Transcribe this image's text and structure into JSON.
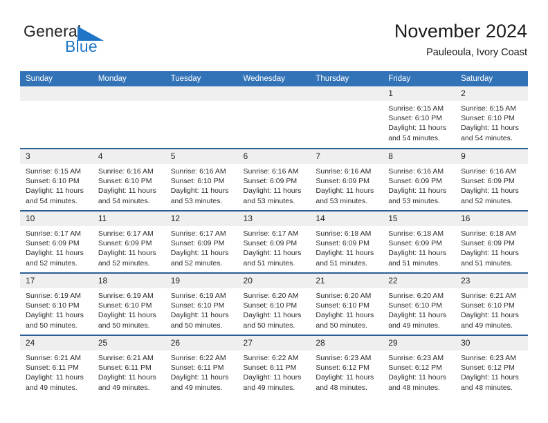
{
  "brand": {
    "name_part1": "General",
    "name_part2": "Blue",
    "triangle_color": "#1f76c7"
  },
  "header": {
    "title": "November 2024",
    "subtitle": "Pauleoula, Ivory Coast"
  },
  "theme": {
    "header_blue": "#3273b8",
    "row_divider": "#2a5f96",
    "daynum_band": "#efefef"
  },
  "weekdays": [
    "Sunday",
    "Monday",
    "Tuesday",
    "Wednesday",
    "Thursday",
    "Friday",
    "Saturday"
  ],
  "labels": {
    "sunrise": "Sunrise:",
    "sunset": "Sunset:",
    "daylight": "Daylight:"
  },
  "weeks": [
    [
      {
        "blank": true
      },
      {
        "blank": true
      },
      {
        "blank": true
      },
      {
        "blank": true
      },
      {
        "blank": true
      },
      {
        "day": "1",
        "sunrise": "Sunrise: 6:15 AM",
        "sunset": "Sunset: 6:10 PM",
        "daylight": "Daylight: 11 hours and 54 minutes."
      },
      {
        "day": "2",
        "sunrise": "Sunrise: 6:15 AM",
        "sunset": "Sunset: 6:10 PM",
        "daylight": "Daylight: 11 hours and 54 minutes."
      }
    ],
    [
      {
        "day": "3",
        "sunrise": "Sunrise: 6:15 AM",
        "sunset": "Sunset: 6:10 PM",
        "daylight": "Daylight: 11 hours and 54 minutes."
      },
      {
        "day": "4",
        "sunrise": "Sunrise: 6:16 AM",
        "sunset": "Sunset: 6:10 PM",
        "daylight": "Daylight: 11 hours and 54 minutes."
      },
      {
        "day": "5",
        "sunrise": "Sunrise: 6:16 AM",
        "sunset": "Sunset: 6:10 PM",
        "daylight": "Daylight: 11 hours and 53 minutes."
      },
      {
        "day": "6",
        "sunrise": "Sunrise: 6:16 AM",
        "sunset": "Sunset: 6:09 PM",
        "daylight": "Daylight: 11 hours and 53 minutes."
      },
      {
        "day": "7",
        "sunrise": "Sunrise: 6:16 AM",
        "sunset": "Sunset: 6:09 PM",
        "daylight": "Daylight: 11 hours and 53 minutes."
      },
      {
        "day": "8",
        "sunrise": "Sunrise: 6:16 AM",
        "sunset": "Sunset: 6:09 PM",
        "daylight": "Daylight: 11 hours and 53 minutes."
      },
      {
        "day": "9",
        "sunrise": "Sunrise: 6:16 AM",
        "sunset": "Sunset: 6:09 PM",
        "daylight": "Daylight: 11 hours and 52 minutes."
      }
    ],
    [
      {
        "day": "10",
        "sunrise": "Sunrise: 6:17 AM",
        "sunset": "Sunset: 6:09 PM",
        "daylight": "Daylight: 11 hours and 52 minutes."
      },
      {
        "day": "11",
        "sunrise": "Sunrise: 6:17 AM",
        "sunset": "Sunset: 6:09 PM",
        "daylight": "Daylight: 11 hours and 52 minutes."
      },
      {
        "day": "12",
        "sunrise": "Sunrise: 6:17 AM",
        "sunset": "Sunset: 6:09 PM",
        "daylight": "Daylight: 11 hours and 52 minutes."
      },
      {
        "day": "13",
        "sunrise": "Sunrise: 6:17 AM",
        "sunset": "Sunset: 6:09 PM",
        "daylight": "Daylight: 11 hours and 51 minutes."
      },
      {
        "day": "14",
        "sunrise": "Sunrise: 6:18 AM",
        "sunset": "Sunset: 6:09 PM",
        "daylight": "Daylight: 11 hours and 51 minutes."
      },
      {
        "day": "15",
        "sunrise": "Sunrise: 6:18 AM",
        "sunset": "Sunset: 6:09 PM",
        "daylight": "Daylight: 11 hours and 51 minutes."
      },
      {
        "day": "16",
        "sunrise": "Sunrise: 6:18 AM",
        "sunset": "Sunset: 6:09 PM",
        "daylight": "Daylight: 11 hours and 51 minutes."
      }
    ],
    [
      {
        "day": "17",
        "sunrise": "Sunrise: 6:19 AM",
        "sunset": "Sunset: 6:10 PM",
        "daylight": "Daylight: 11 hours and 50 minutes."
      },
      {
        "day": "18",
        "sunrise": "Sunrise: 6:19 AM",
        "sunset": "Sunset: 6:10 PM",
        "daylight": "Daylight: 11 hours and 50 minutes."
      },
      {
        "day": "19",
        "sunrise": "Sunrise: 6:19 AM",
        "sunset": "Sunset: 6:10 PM",
        "daylight": "Daylight: 11 hours and 50 minutes."
      },
      {
        "day": "20",
        "sunrise": "Sunrise: 6:20 AM",
        "sunset": "Sunset: 6:10 PM",
        "daylight": "Daylight: 11 hours and 50 minutes."
      },
      {
        "day": "21",
        "sunrise": "Sunrise: 6:20 AM",
        "sunset": "Sunset: 6:10 PM",
        "daylight": "Daylight: 11 hours and 50 minutes."
      },
      {
        "day": "22",
        "sunrise": "Sunrise: 6:20 AM",
        "sunset": "Sunset: 6:10 PM",
        "daylight": "Daylight: 11 hours and 49 minutes."
      },
      {
        "day": "23",
        "sunrise": "Sunrise: 6:21 AM",
        "sunset": "Sunset: 6:10 PM",
        "daylight": "Daylight: 11 hours and 49 minutes."
      }
    ],
    [
      {
        "day": "24",
        "sunrise": "Sunrise: 6:21 AM",
        "sunset": "Sunset: 6:11 PM",
        "daylight": "Daylight: 11 hours and 49 minutes."
      },
      {
        "day": "25",
        "sunrise": "Sunrise: 6:21 AM",
        "sunset": "Sunset: 6:11 PM",
        "daylight": "Daylight: 11 hours and 49 minutes."
      },
      {
        "day": "26",
        "sunrise": "Sunrise: 6:22 AM",
        "sunset": "Sunset: 6:11 PM",
        "daylight": "Daylight: 11 hours and 49 minutes."
      },
      {
        "day": "27",
        "sunrise": "Sunrise: 6:22 AM",
        "sunset": "Sunset: 6:11 PM",
        "daylight": "Daylight: 11 hours and 49 minutes."
      },
      {
        "day": "28",
        "sunrise": "Sunrise: 6:23 AM",
        "sunset": "Sunset: 6:12 PM",
        "daylight": "Daylight: 11 hours and 48 minutes."
      },
      {
        "day": "29",
        "sunrise": "Sunrise: 6:23 AM",
        "sunset": "Sunset: 6:12 PM",
        "daylight": "Daylight: 11 hours and 48 minutes."
      },
      {
        "day": "30",
        "sunrise": "Sunrise: 6:23 AM",
        "sunset": "Sunset: 6:12 PM",
        "daylight": "Daylight: 11 hours and 48 minutes."
      }
    ]
  ]
}
